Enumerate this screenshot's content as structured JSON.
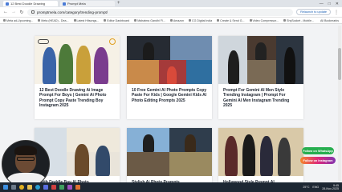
{
  "browser": {
    "tabs": [
      {
        "label": "12 Best Doodle Drawing"
      },
      {
        "label": "Prompt Mela"
      }
    ],
    "url": "promptmela.com/category/trending-prompt/",
    "relaunch_label": "Relaunch to update",
    "bookmarks": [
      "Meta ad-Upcoming...",
      "Meta (HEAD) - Dea...",
      "Latest Hitsongs...",
      "Editor Dashboard",
      "Mahatma Gandhi Fl...",
      "Amazon",
      "CG Digital India",
      "Create & Send G...",
      "Video Compressor...",
      "ShySocket - Mobile..."
    ],
    "all_bookmarks_label": "All Bookmarks"
  },
  "cards": [
    {
      "title": "12 Best Doodle Drawing Ai Image Prompt For Boys | Gemini Ai Photo Prompt Copy Paste Trending Boy Instagram 2025"
    },
    {
      "title": "10 Free Gemini AI Photo Prompts Copy Paste For Kids | Google Gemini Kids AI Photo Editing Prompts 2025"
    },
    {
      "title": "Prompt For Gemini AI Men Style Trending Instagram | Prompt For Gemini AI Men Instagram Trending 2025"
    },
    {
      "title": "With Doddle Boy AI Photo"
    },
    {
      "title": "Stylish Ai Photo Prompts"
    },
    {
      "title": "Hollywood Style Prompt AI"
    }
  ],
  "floating": {
    "whatsapp_label": "Follow on WhatsApp",
    "instagram_label": "Follow on Instagram"
  },
  "taskbar": {
    "weather": "25°C",
    "lang": "ENG",
    "time": "9:45",
    "date": "28-Nov-2025"
  },
  "colors": {
    "whatsapp": "#27ae4f",
    "taskbar": "#1d2733",
    "title_text": "#1d2430"
  },
  "icons": [
    "back-icon",
    "forward-icon",
    "reload-icon",
    "lock-icon",
    "menu-icon",
    "search-icon",
    "windows-icon"
  ]
}
